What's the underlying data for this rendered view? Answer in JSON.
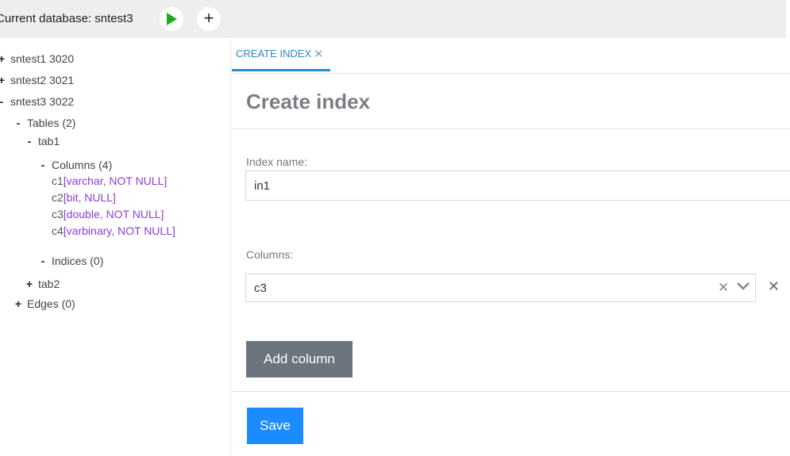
{
  "header": {
    "current_database_label": "Current database: sntest3",
    "run_icon": "play-icon",
    "add_icon": "plus-icon"
  },
  "tree": {
    "nodes": [
      {
        "toggle": "+",
        "label": "sntest1 3020"
      },
      {
        "toggle": "+",
        "label": "sntest2 3021"
      },
      {
        "toggle": "-",
        "label": "sntest3 3022"
      },
      {
        "toggle": "-",
        "label": "Tables (2)"
      },
      {
        "toggle": "-",
        "label": "tab1"
      },
      {
        "toggle": "-",
        "label": "Columns (4)"
      },
      {
        "toggle": "-",
        "label": "Indices (0)"
      },
      {
        "toggle": "+",
        "label": "tab2"
      },
      {
        "toggle": "+",
        "label": "Edges (0)"
      }
    ],
    "columns": [
      {
        "name": "c1",
        "type": "[varchar, NOT NULL]"
      },
      {
        "name": "c2",
        "type": "[bit, NULL]"
      },
      {
        "name": "c3",
        "type": "[double, NOT NULL]"
      },
      {
        "name": "c4",
        "type": "[varbinary, NOT NULL]"
      }
    ]
  },
  "tab": {
    "label": "CREATE INDEX",
    "close_icon": "close-icon"
  },
  "form": {
    "title": "Create index",
    "index_name_label": "Index name:",
    "index_name_value": "in1",
    "columns_label": "Columns:",
    "column_value": "c3",
    "add_column_label": "Add column",
    "save_label": "Save"
  },
  "colors": {
    "accent": "#2a89c7",
    "play_green": "#22aa22",
    "column_type": "#8a3fd8",
    "save_button": "#1a8cff",
    "secondary_button": "#6c757d"
  }
}
